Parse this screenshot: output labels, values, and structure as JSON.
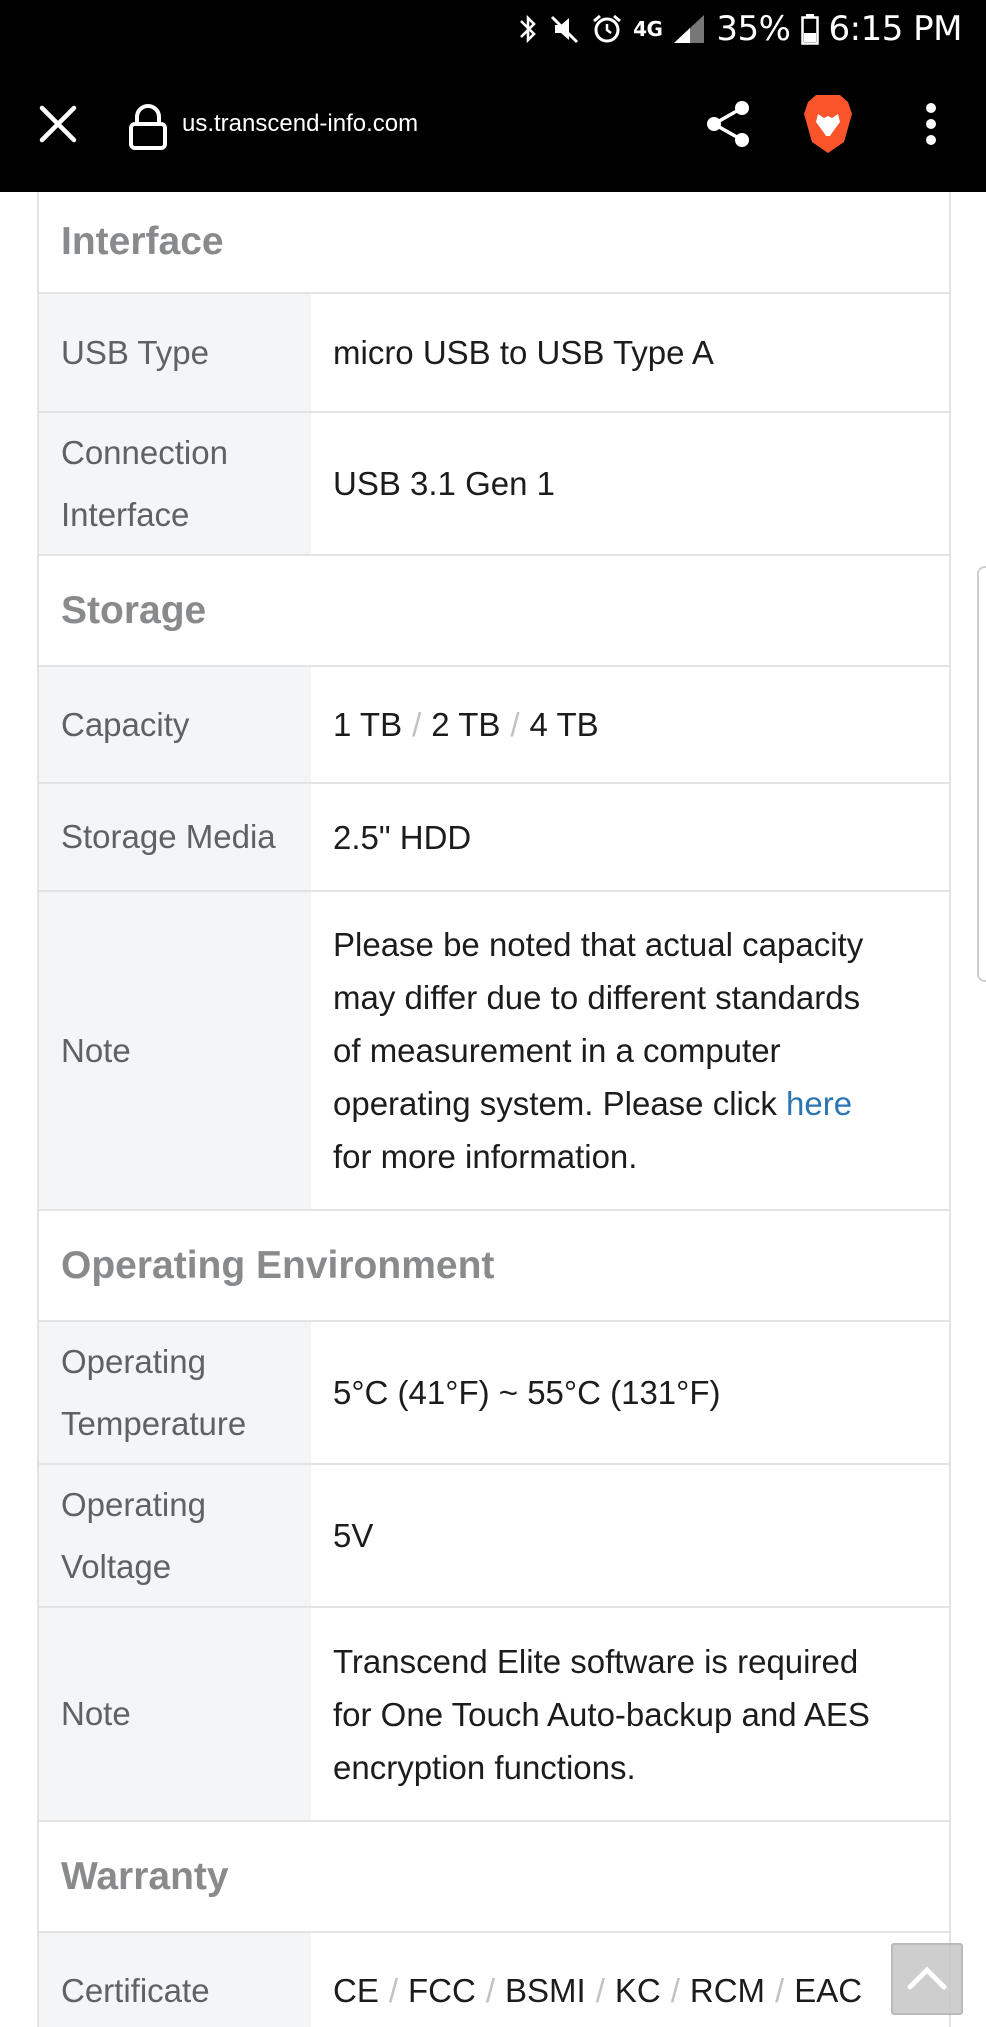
{
  "status_bar": {
    "network": "4G",
    "battery": "35%",
    "time": "6:15 PM"
  },
  "toolbar": {
    "url": "us.transcend-info.com"
  },
  "sections": {
    "interface": {
      "title": "Interface",
      "usb_type_label": "USB Type",
      "usb_type_value": "micro USB to USB Type A",
      "connection_label_1": "Connection",
      "connection_label_2": "Interface",
      "connection_value": "USB 3.1 Gen 1"
    },
    "storage": {
      "title": "Storage",
      "capacity_label": "Capacity",
      "capacity_values": [
        "1 TB",
        "2 TB",
        "4 TB"
      ],
      "media_label": "Storage Media",
      "media_value": "2.5\" HDD",
      "note_label": "Note",
      "note_line_1": "Please be noted that actual capacity",
      "note_line_2": "may differ due to different standards",
      "note_line_3": "of measurement in a computer",
      "note_line_4_pre": "operating system. Please click ",
      "note_link": "here",
      "note_line_5": "for more information."
    },
    "environment": {
      "title": "Operating Environment",
      "temp_label_1": "Operating",
      "temp_label_2": "Temperature",
      "temp_value": "5°C (41°F) ~ 55°C (131°F)",
      "voltage_label_1": "Operating",
      "voltage_label_2": "Voltage",
      "voltage_value": "5V",
      "note_label": "Note",
      "note_line_1": "Transcend Elite software is required",
      "note_line_2": "for One Touch Auto-backup and AES",
      "note_line_3": "encryption functions."
    },
    "warranty": {
      "title": "Warranty",
      "certificate_label": "Certificate",
      "certificate_values": [
        "CE",
        "FCC",
        "BSMI",
        "KC",
        "RCM",
        "EAC"
      ]
    }
  },
  "icons": {
    "close": "close-icon",
    "lock": "lock-icon",
    "share": "share-icon",
    "brave": "brave-lion-icon",
    "menu": "more-vertical-icon",
    "scroll_top": "chevron-up-icon"
  },
  "colors": {
    "section_title": "#888a8c",
    "label_bg": "#f4f5f7",
    "link": "#2c75b3",
    "brave": "#fb542b"
  }
}
